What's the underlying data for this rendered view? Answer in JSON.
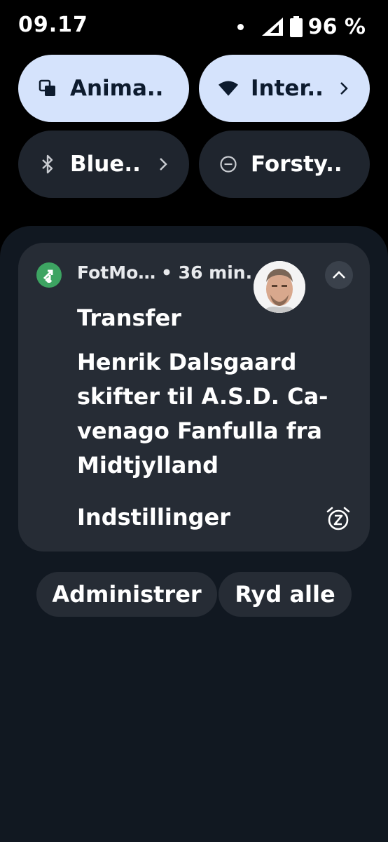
{
  "status_bar": {
    "time": "09.17",
    "battery": "96 %"
  },
  "quick_settings": {
    "tiles": [
      {
        "label": "Anima..",
        "icon": "screen-cast-icon",
        "active": true,
        "chevron": false
      },
      {
        "label": "Inter..",
        "icon": "wifi-icon",
        "active": true,
        "chevron": true
      },
      {
        "label": "Blue..",
        "icon": "bluetooth-icon",
        "active": false,
        "chevron": true
      },
      {
        "label": "Forsty..",
        "icon": "do-not-disturb-icon",
        "active": false,
        "chevron": false
      }
    ]
  },
  "notification": {
    "app_name": "FotMo…",
    "time": "• 36 min.",
    "title": "Transfer",
    "body_lines": [
      "Henrik Dalsgaard",
      "skifter til A.S.D. Ca-",
      "venago Fanfulla fra",
      "Midtjylland"
    ],
    "action": "Indstillinger",
    "app_icon": "fotmob-transfer-icon",
    "accent_color": "#3da462"
  },
  "footer": {
    "manage_label": "Administrer",
    "clear_label": "Ryd alle"
  },
  "colors": {
    "tile_active": "#d5e3fc",
    "tile_inactive": "#1f252e",
    "shade_background": "#111821",
    "card_background": "#262c35"
  }
}
